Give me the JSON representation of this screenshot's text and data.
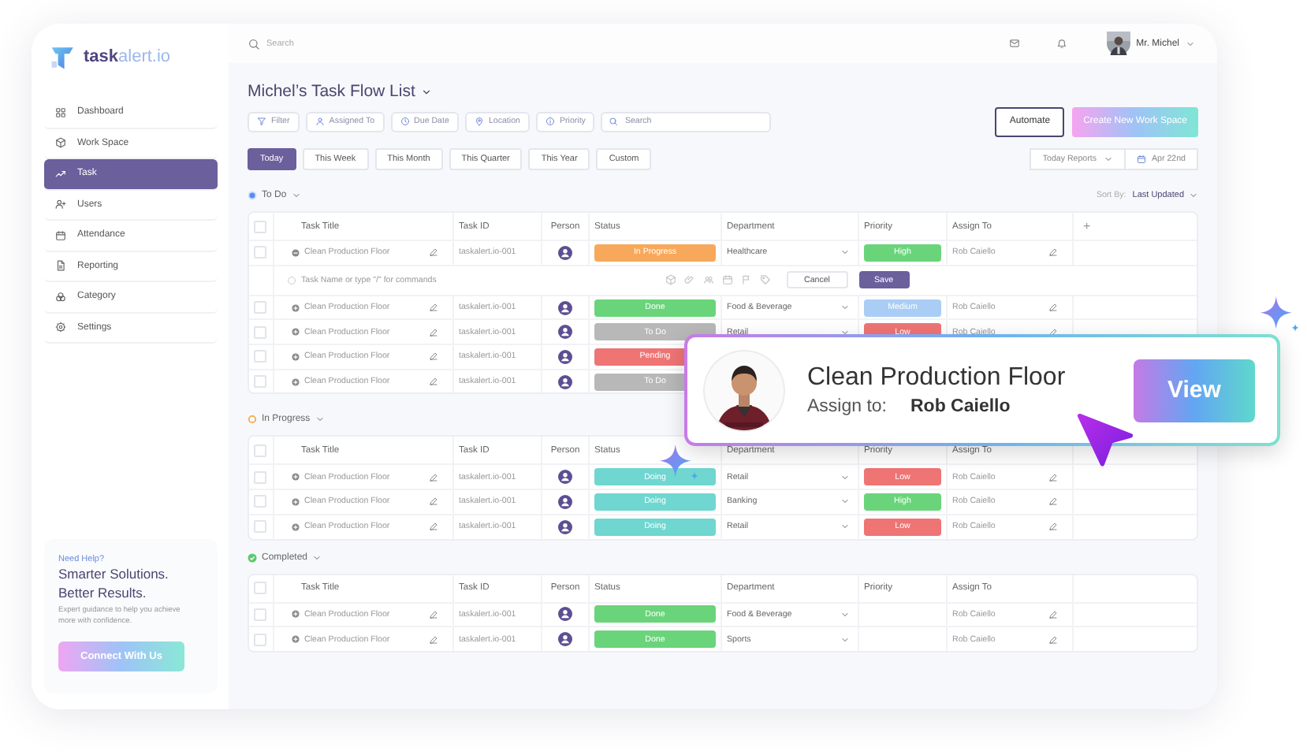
{
  "logo": "**task**alert.io",
  "sidebar": {
    "items": [
      {
        "label": "Dashboard",
        "selected": false
      },
      {
        "label": "Work Space",
        "selected": false
      },
      {
        "label": "Task",
        "selected": true
      },
      {
        "label": "Users",
        "selected": false
      },
      {
        "label": "Attendance",
        "selected": false
      },
      {
        "label": "Reporting",
        "selected": false
      },
      {
        "label": "Category",
        "selected": false
      },
      {
        "label": "Settings",
        "selected": false
      }
    ],
    "help": {
      "kicker": "Need Help?",
      "headline": [
        "Smarter Solutions.",
        "Better Results."
      ],
      "text": "Expert guidance to help you achieve more with confidence.",
      "button": "Connect With Us"
    }
  },
  "topbar": {
    "search_placeholder": "Search",
    "user": "Mr. Michel"
  },
  "page": {
    "title": "Michel’s Task Flow List",
    "filters": [
      "Filter",
      "Assigned To",
      "Due Date",
      "Location",
      "Priority"
    ],
    "search_placeholder": "Search",
    "actions": [
      "Automate",
      "Create New Work Space"
    ],
    "periods": [
      {
        "label": "Today",
        "selected": true
      },
      {
        "label": "This Week",
        "selected": false
      },
      {
        "label": "This Month",
        "selected": false
      },
      {
        "label": "This Quarter",
        "selected": false
      },
      {
        "label": "This Year",
        "selected": false
      },
      {
        "label": "Custom",
        "selected": false
      }
    ],
    "reports": "Today Reports",
    "date": "Apr 22nd"
  },
  "groups": [
    {
      "name": "To Do",
      "kind": "todo",
      "add_label": "+",
      "all_checked": false,
      "sort": {
        "label": "Sort By:",
        "value": "Last Updated"
      },
      "columns": [
        "Task Title",
        "Task ID",
        "Person",
        "Status",
        "Department",
        "Priority",
        "Assign To"
      ],
      "rows": [
        {
          "checked": false,
          "expanded": true,
          "title": "Clean Production Floor",
          "id": "taskalert.io-001",
          "status": {
            "label": "In Progress",
            "color": "#f7a85a"
          },
          "department": "Healthcare",
          "priority": {
            "label": "High",
            "color": "#6ad47a"
          },
          "assignee": "Rob Caiello"
        },
        {
          "kind": "new_task",
          "placeholder": "Task Name or type \"/\" for commands",
          "buttons": [
            "Cancel",
            "Save"
          ]
        },
        {
          "checked": false,
          "expanded": false,
          "title": "Clean Production Floor",
          "id": "taskalert.io-001",
          "status": {
            "label": "Done",
            "color": "#6ad47a"
          },
          "department": "Food & Beverage",
          "priority": {
            "label": "Medium",
            "color": "#a9cdf5"
          },
          "assignee": "Rob Caiello"
        },
        {
          "checked": false,
          "expanded": false,
          "title": "Clean Production Floor",
          "id": "taskalert.io-001",
          "status": {
            "label": "To Do",
            "color": "#b8b8b8"
          },
          "department": "Retail",
          "priority": {
            "label": "Low",
            "color": "#ef7474"
          },
          "assignee": "Rob Caiello"
        },
        {
          "checked": false,
          "expanded": false,
          "title": "Clean Production Floor",
          "id": "taskalert.io-001",
          "status": {
            "label": "Pending",
            "color": "#ef7474"
          }
        },
        {
          "checked": false,
          "expanded": false,
          "title": "Clean Production Floor",
          "id": "taskalert.io-001",
          "status": {
            "label": "To Do",
            "color": "#b8b8b8"
          }
        }
      ]
    },
    {
      "name": "In Progress",
      "kind": "progress",
      "all_checked": false,
      "columns": [
        "Task Title",
        "Task ID",
        "Person",
        "Status",
        "Department",
        "Priority",
        "Assign To"
      ],
      "rows": [
        {
          "checked": false,
          "expanded": false,
          "title": "Clean Production Floor",
          "id": "taskalert.io-001",
          "status": {
            "label": "Doing",
            "color": "#6fd6d0"
          },
          "department": "Retail",
          "priority": {
            "label": "Low",
            "color": "#ef7474"
          },
          "assignee": "Rob Caiello"
        },
        {
          "checked": false,
          "expanded": false,
          "title": "Clean Production Floor",
          "id": "taskalert.io-001",
          "status": {
            "label": "Doing",
            "color": "#6fd6d0"
          },
          "department": "Banking",
          "priority": {
            "label": "High",
            "color": "#6ad47a"
          },
          "assignee": "Rob Caiello"
        },
        {
          "checked": false,
          "expanded": false,
          "title": "Clean Production Floor",
          "id": "taskalert.io-001",
          "status": {
            "label": "Doing",
            "color": "#6fd6d0"
          },
          "department": "Retail",
          "priority": {
            "label": "Low",
            "color": "#ef7474"
          },
          "assignee": "Rob Caiello"
        }
      ]
    },
    {
      "name": "Completed",
      "kind": "done",
      "all_checked": false,
      "columns": [
        "Task Title",
        "Task ID",
        "Person",
        "Status",
        "Department",
        "Priority",
        "Assign To"
      ],
      "rows": [
        {
          "checked": false,
          "expanded": false,
          "title": "Clean Production Floor",
          "id": "taskalert.io-001",
          "status": {
            "label": "Done",
            "color": "#6ad47a"
          },
          "department": "Food & Beverage",
          "assignee": "Rob Caiello"
        },
        {
          "checked": false,
          "expanded": false,
          "title": "Clean Production Floor",
          "id": "taskalert.io-001",
          "status": {
            "label": "Done",
            "color": "#6ad47a"
          },
          "department": "Sports",
          "assignee": "Rob Caiello"
        }
      ]
    }
  ],
  "popup": {
    "title": "Clean Production Floor",
    "assign_label": "Assign to:",
    "assignee": "Rob Caiello",
    "button": "View"
  }
}
